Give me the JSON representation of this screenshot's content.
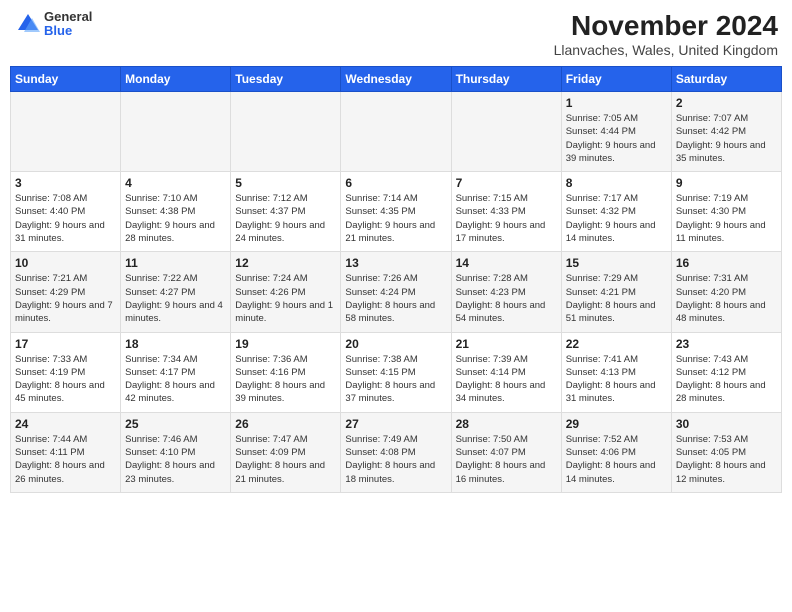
{
  "logo": {
    "general": "General",
    "blue": "Blue"
  },
  "header": {
    "month_year": "November 2024",
    "location": "Llanvaches, Wales, United Kingdom"
  },
  "days_of_week": [
    "Sunday",
    "Monday",
    "Tuesday",
    "Wednesday",
    "Thursday",
    "Friday",
    "Saturday"
  ],
  "weeks": [
    [
      {
        "day": "",
        "info": ""
      },
      {
        "day": "",
        "info": ""
      },
      {
        "day": "",
        "info": ""
      },
      {
        "day": "",
        "info": ""
      },
      {
        "day": "",
        "info": ""
      },
      {
        "day": "1",
        "info": "Sunrise: 7:05 AM\nSunset: 4:44 PM\nDaylight: 9 hours\nand 39 minutes."
      },
      {
        "day": "2",
        "info": "Sunrise: 7:07 AM\nSunset: 4:42 PM\nDaylight: 9 hours\nand 35 minutes."
      }
    ],
    [
      {
        "day": "3",
        "info": "Sunrise: 7:08 AM\nSunset: 4:40 PM\nDaylight: 9 hours\nand 31 minutes."
      },
      {
        "day": "4",
        "info": "Sunrise: 7:10 AM\nSunset: 4:38 PM\nDaylight: 9 hours\nand 28 minutes."
      },
      {
        "day": "5",
        "info": "Sunrise: 7:12 AM\nSunset: 4:37 PM\nDaylight: 9 hours\nand 24 minutes."
      },
      {
        "day": "6",
        "info": "Sunrise: 7:14 AM\nSunset: 4:35 PM\nDaylight: 9 hours\nand 21 minutes."
      },
      {
        "day": "7",
        "info": "Sunrise: 7:15 AM\nSunset: 4:33 PM\nDaylight: 9 hours\nand 17 minutes."
      },
      {
        "day": "8",
        "info": "Sunrise: 7:17 AM\nSunset: 4:32 PM\nDaylight: 9 hours\nand 14 minutes."
      },
      {
        "day": "9",
        "info": "Sunrise: 7:19 AM\nSunset: 4:30 PM\nDaylight: 9 hours\nand 11 minutes."
      }
    ],
    [
      {
        "day": "10",
        "info": "Sunrise: 7:21 AM\nSunset: 4:29 PM\nDaylight: 9 hours\nand 7 minutes."
      },
      {
        "day": "11",
        "info": "Sunrise: 7:22 AM\nSunset: 4:27 PM\nDaylight: 9 hours\nand 4 minutes."
      },
      {
        "day": "12",
        "info": "Sunrise: 7:24 AM\nSunset: 4:26 PM\nDaylight: 9 hours\nand 1 minute."
      },
      {
        "day": "13",
        "info": "Sunrise: 7:26 AM\nSunset: 4:24 PM\nDaylight: 8 hours\nand 58 minutes."
      },
      {
        "day": "14",
        "info": "Sunrise: 7:28 AM\nSunset: 4:23 PM\nDaylight: 8 hours\nand 54 minutes."
      },
      {
        "day": "15",
        "info": "Sunrise: 7:29 AM\nSunset: 4:21 PM\nDaylight: 8 hours\nand 51 minutes."
      },
      {
        "day": "16",
        "info": "Sunrise: 7:31 AM\nSunset: 4:20 PM\nDaylight: 8 hours\nand 48 minutes."
      }
    ],
    [
      {
        "day": "17",
        "info": "Sunrise: 7:33 AM\nSunset: 4:19 PM\nDaylight: 8 hours\nand 45 minutes."
      },
      {
        "day": "18",
        "info": "Sunrise: 7:34 AM\nSunset: 4:17 PM\nDaylight: 8 hours\nand 42 minutes."
      },
      {
        "day": "19",
        "info": "Sunrise: 7:36 AM\nSunset: 4:16 PM\nDaylight: 8 hours\nand 39 minutes."
      },
      {
        "day": "20",
        "info": "Sunrise: 7:38 AM\nSunset: 4:15 PM\nDaylight: 8 hours\nand 37 minutes."
      },
      {
        "day": "21",
        "info": "Sunrise: 7:39 AM\nSunset: 4:14 PM\nDaylight: 8 hours\nand 34 minutes."
      },
      {
        "day": "22",
        "info": "Sunrise: 7:41 AM\nSunset: 4:13 PM\nDaylight: 8 hours\nand 31 minutes."
      },
      {
        "day": "23",
        "info": "Sunrise: 7:43 AM\nSunset: 4:12 PM\nDaylight: 8 hours\nand 28 minutes."
      }
    ],
    [
      {
        "day": "24",
        "info": "Sunrise: 7:44 AM\nSunset: 4:11 PM\nDaylight: 8 hours\nand 26 minutes."
      },
      {
        "day": "25",
        "info": "Sunrise: 7:46 AM\nSunset: 4:10 PM\nDaylight: 8 hours\nand 23 minutes."
      },
      {
        "day": "26",
        "info": "Sunrise: 7:47 AM\nSunset: 4:09 PM\nDaylight: 8 hours\nand 21 minutes."
      },
      {
        "day": "27",
        "info": "Sunrise: 7:49 AM\nSunset: 4:08 PM\nDaylight: 8 hours\nand 18 minutes."
      },
      {
        "day": "28",
        "info": "Sunrise: 7:50 AM\nSunset: 4:07 PM\nDaylight: 8 hours\nand 16 minutes."
      },
      {
        "day": "29",
        "info": "Sunrise: 7:52 AM\nSunset: 4:06 PM\nDaylight: 8 hours\nand 14 minutes."
      },
      {
        "day": "30",
        "info": "Sunrise: 7:53 AM\nSunset: 4:05 PM\nDaylight: 8 hours\nand 12 minutes."
      }
    ]
  ]
}
